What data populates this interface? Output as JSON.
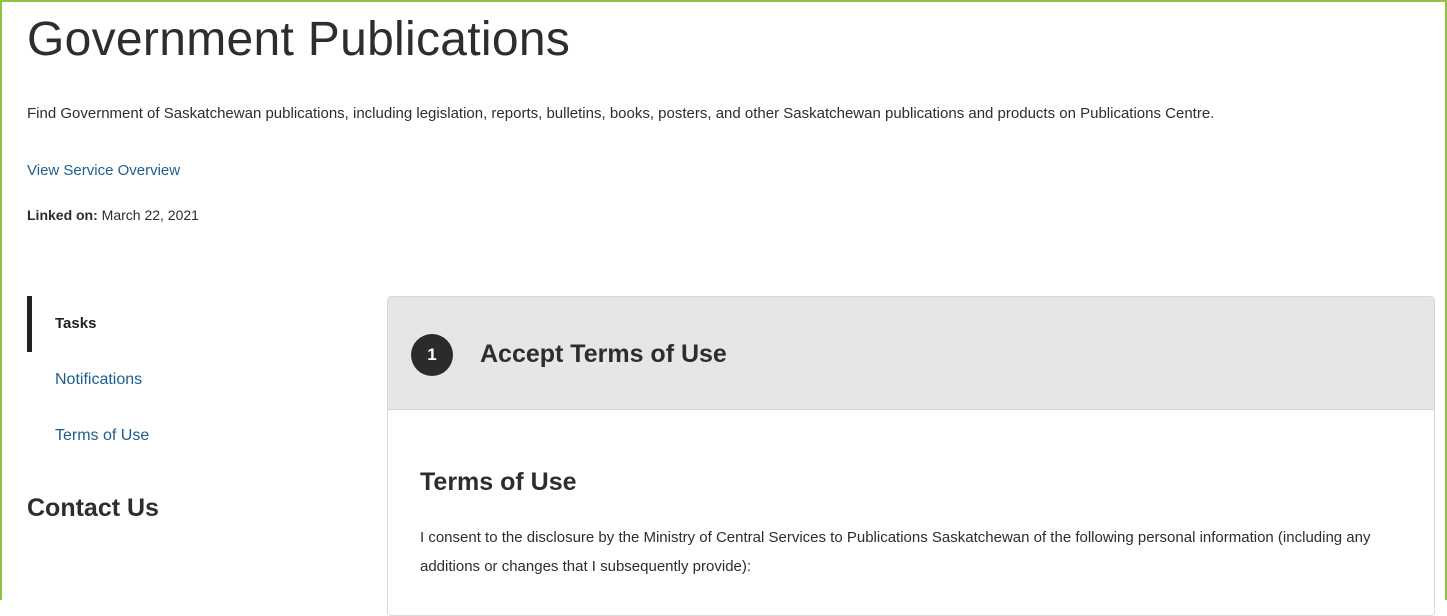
{
  "header": {
    "title": "Government Publications",
    "description": "Find Government of Saskatchewan publications, including legislation, reports, bulletins, books, posters, and other Saskatchewan publications and products on Publications Centre.",
    "overview_link": "View Service Overview",
    "linked_on_label": "Linked on:",
    "linked_on_date": "March 22, 2021"
  },
  "sidebar": {
    "items": [
      {
        "label": "Tasks",
        "active": true
      },
      {
        "label": "Notifications",
        "active": false
      },
      {
        "label": "Terms of Use",
        "active": false
      }
    ],
    "contact_heading": "Contact Us"
  },
  "task_card": {
    "step_number": "1",
    "step_title": "Accept Terms of Use",
    "section_heading": "Terms of Use",
    "body_text": "I consent to the disclosure by the Ministry of Central Services to Publications Saskatchewan of the following personal information (including any additions or changes that I subsequently provide):"
  },
  "colors": {
    "frame_border": "#8cc63f",
    "link": "#1f5d8c",
    "card_header_bg": "#e6e6e8",
    "badge_bg": "#2b2b2b"
  }
}
